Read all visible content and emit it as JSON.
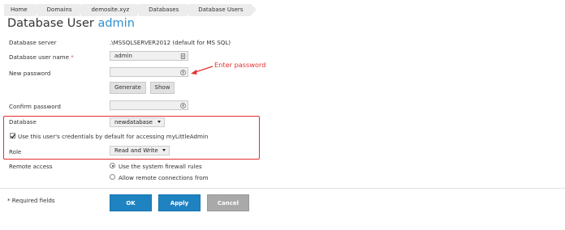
{
  "breadcrumb": [
    "Home",
    "Domains",
    "demosite.xyz",
    "Databases",
    "Database Users"
  ],
  "title": {
    "prefix": "Database User ",
    "user": "admin"
  },
  "form": {
    "server_label": "Database server",
    "server_value": ".\\MSSQLSERVER2012 (default for MS SQL)",
    "username_label": "Database user name",
    "username_required_mark": "*",
    "username_value": "admin",
    "new_password_label": "New password",
    "new_password_value": "",
    "generate_label": "Generate",
    "show_label": "Show",
    "confirm_label": "Confirm password",
    "confirm_value": "",
    "database_label": "Database",
    "database_value": "newdatabase",
    "use_credentials_label": "Use this user's credentials by default for accessing myLittleAdmin",
    "use_credentials_checked": true,
    "role_label": "Role",
    "role_value": "Read and Write",
    "remote_label": "Remote access",
    "remote_options": [
      "Use the system firewall rules",
      "Allow remote connections from"
    ],
    "remote_selected": 0,
    "required_note": "* Required fields"
  },
  "buttons": {
    "ok": "OK",
    "apply": "Apply",
    "cancel": "Cancel"
  },
  "annotation": {
    "text": "Enter password",
    "color": "#e53030"
  },
  "colors": {
    "accent": "#1f83c2",
    "title_user": "#2f8fd0",
    "highlight_box": "#e53030"
  },
  "icons": {
    "field_icon": "keyboard-icon",
    "password_icon": "key-icon"
  }
}
